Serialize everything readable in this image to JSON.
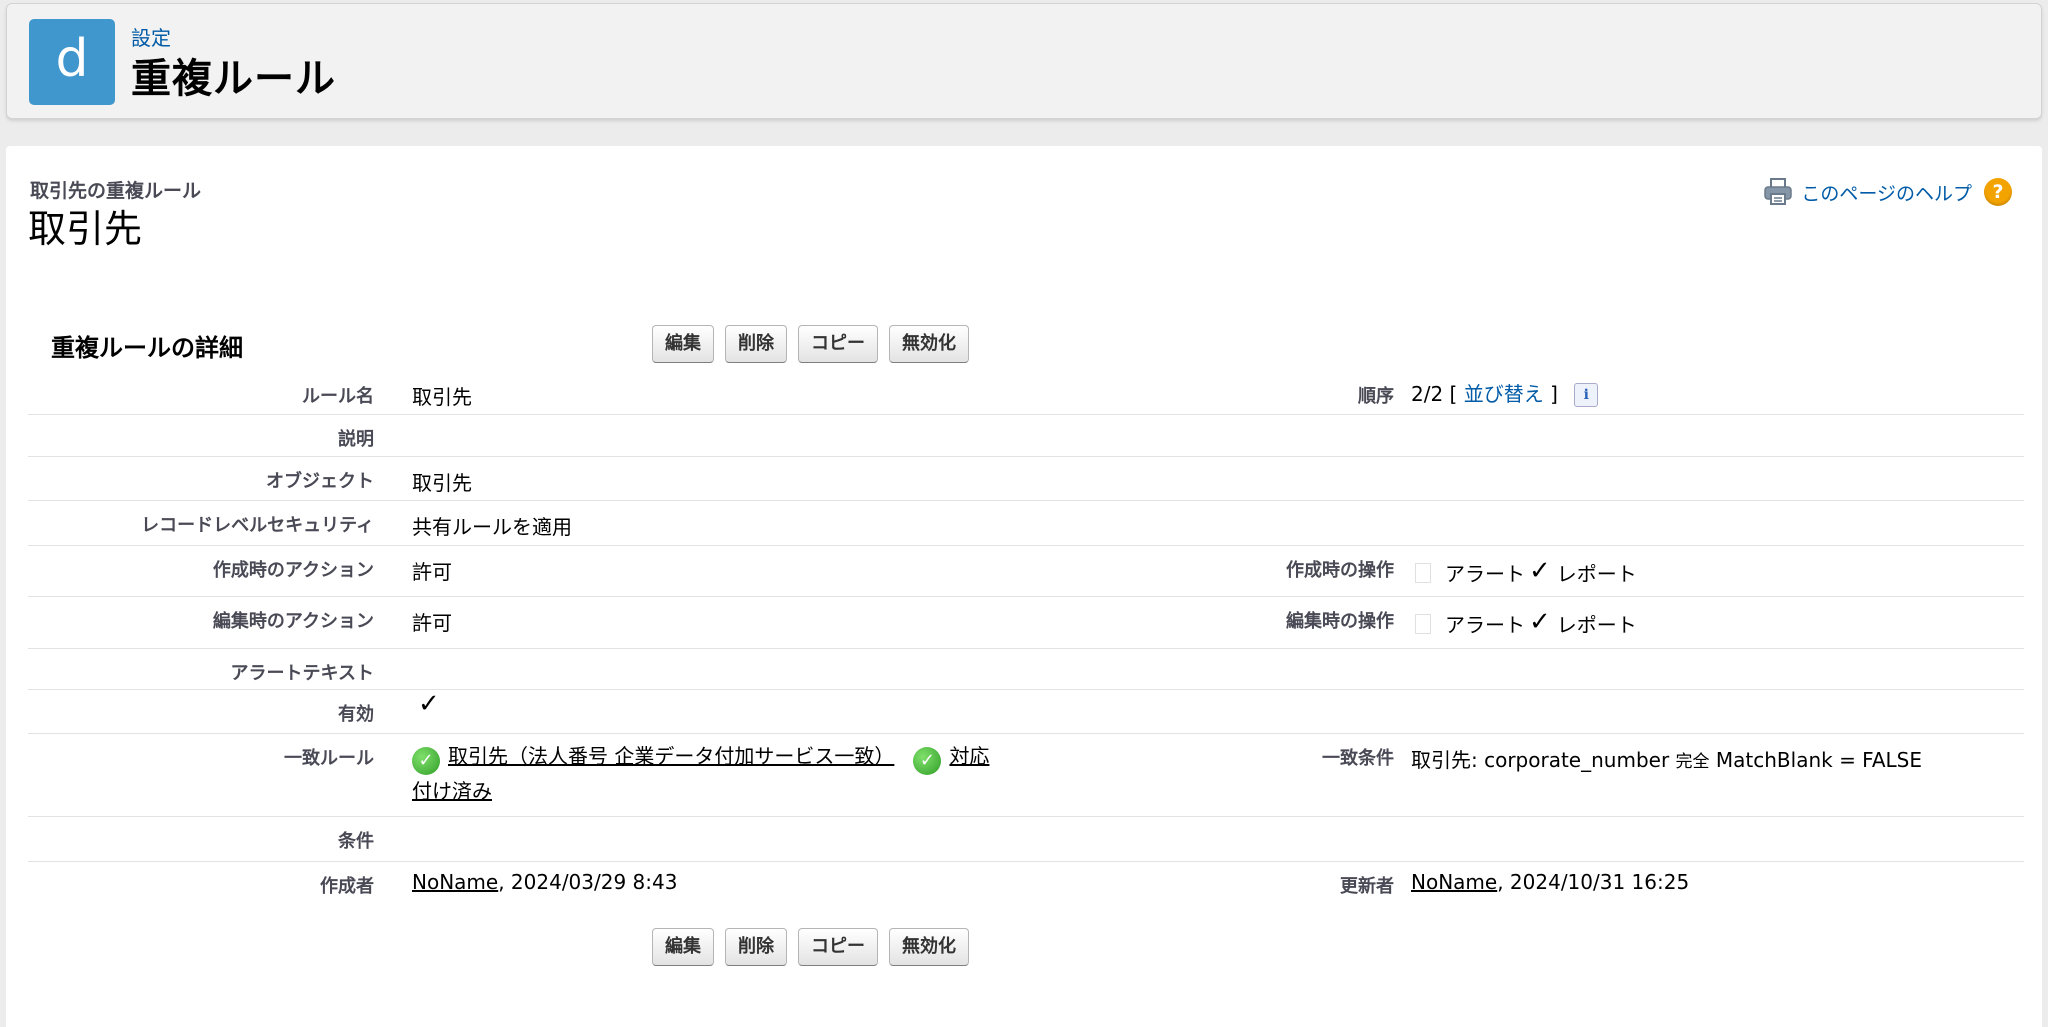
{
  "header": {
    "app_icon_letter": "d",
    "breadcrumb": "設定",
    "title": "重複ルール"
  },
  "page": {
    "subtitle": "取引先の重複ルール",
    "title": "取引先",
    "help_link": "このページのヘルプ"
  },
  "section": {
    "title": "重複ルールの詳細"
  },
  "buttons": {
    "edit": "編集",
    "delete": "削除",
    "copy": "コピー",
    "deactivate": "無効化"
  },
  "fields": {
    "rule_name": {
      "label": "ルール名",
      "value": "取引先"
    },
    "order": {
      "label": "順序",
      "value": "2/2",
      "bracket_open": "[",
      "link": "並び替え",
      "bracket_close": "]",
      "info": "i"
    },
    "description": {
      "label": "説明",
      "value": ""
    },
    "object": {
      "label": "オブジェクト",
      "value": "取引先"
    },
    "record_security": {
      "label": "レコードレベルセキュリティ",
      "value": "共有ルールを適用"
    },
    "create_action": {
      "label": "作成時のアクション",
      "value": "許可"
    },
    "create_operation": {
      "label": "作成時の操作",
      "alert": "アラート",
      "alert_checked": false,
      "report": "レポート",
      "report_checked": true
    },
    "edit_action": {
      "label": "編集時のアクション",
      "value": "許可"
    },
    "edit_operation": {
      "label": "編集時の操作",
      "alert": "アラート",
      "alert_checked": false,
      "report": "レポート",
      "report_checked": true
    },
    "alert_text": {
      "label": "アラートテキスト",
      "value": ""
    },
    "active": {
      "label": "有効",
      "checked": true
    },
    "match_rule": {
      "label": "一致ルール",
      "rule_link": "取引先（法人番号 企業データ付加サービス一致）",
      "status_line1": "対応",
      "status_line2": "付け済み"
    },
    "match_condition": {
      "label": "一致条件",
      "prefix": "取引先: corporate_number",
      "mode": "完全",
      "suffix": "MatchBlank = FALSE"
    },
    "conditions": {
      "label": "条件",
      "value": ""
    },
    "created_by": {
      "label": "作成者",
      "user": "NoName",
      "date": ", 2024/03/29 8:43"
    },
    "modified_by": {
      "label": "更新者",
      "user": "NoName",
      "date": ", 2024/10/31 16:25"
    }
  },
  "colors": {
    "app_icon": "#3f97cd",
    "link": "#015ba7",
    "help_icon": "#f3a300",
    "check_green": "#2f9d27"
  }
}
